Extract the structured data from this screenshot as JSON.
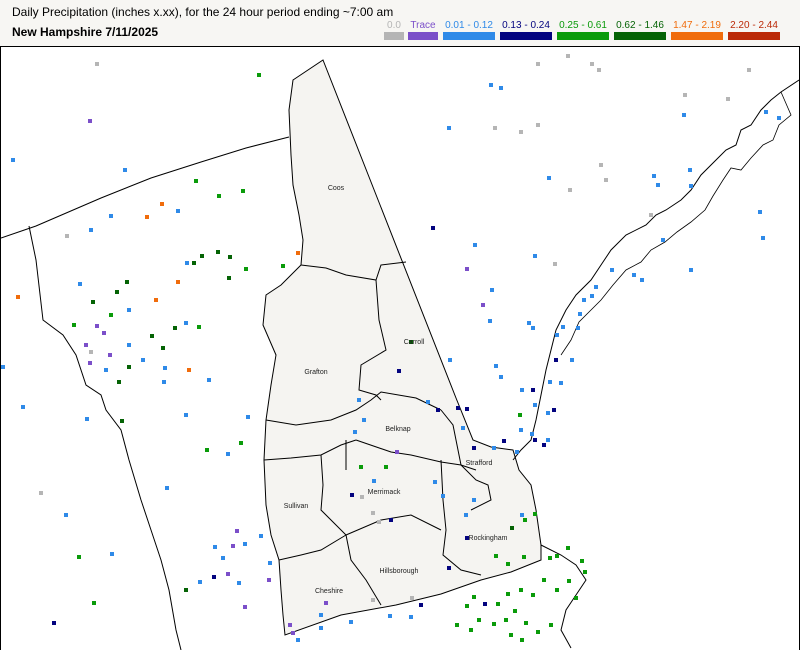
{
  "header": {
    "title": "Daily Precipitation (inches  x.xx),  for the 24 hour period ending ~7:00 am",
    "subtitle": "New Hampshire 7/11/2025"
  },
  "legend": [
    {
      "label": "0.0",
      "color": "#b5b5b5"
    },
    {
      "label": "Trace",
      "color": "#7b4fc9"
    },
    {
      "label": "0.01 - 0.12",
      "color": "#2f8ae8"
    },
    {
      "label": "0.13 - 0.24",
      "color": "#03037f"
    },
    {
      "label": "0.25 - 0.61",
      "color": "#0a9b0a"
    },
    {
      "label": "0.62 - 1.46",
      "color": "#056305"
    },
    {
      "label": "1.47 - 2.19",
      "color": "#f06c0c"
    },
    {
      "label": "2.20 - 2.44",
      "color": "#bb2a08"
    }
  ],
  "counties": [
    "Coos",
    "Carroll",
    "Grafton",
    "Belknap",
    "Strafford",
    "Sullivan",
    "Merrimack",
    "Rockingham",
    "Cheshire",
    "Hillsborough"
  ],
  "map": {
    "state": "New Hampshire",
    "state_fill": "#f5f4f1",
    "boundary_color": "#000000"
  }
}
